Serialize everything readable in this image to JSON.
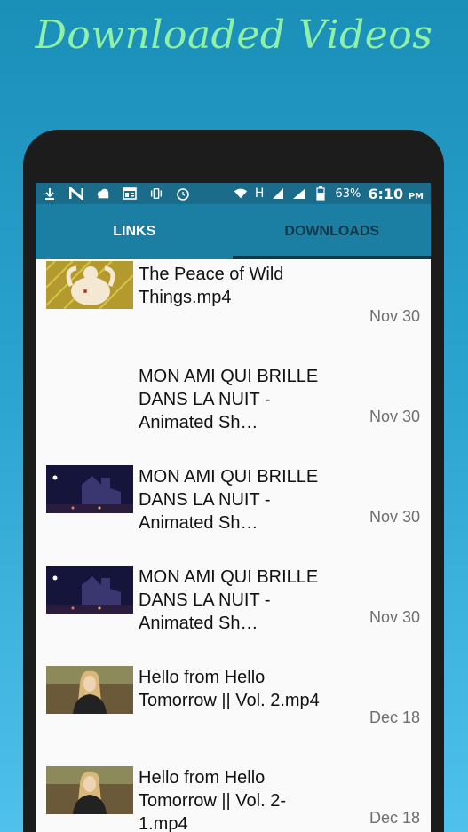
{
  "headline": "Downloaded Videos",
  "status_bar": {
    "icons": [
      "download-icon",
      "n-app-icon",
      "cloud-icon",
      "news-icon",
      "vibrate-icon",
      "alarm-icon",
      "wifi-icon",
      "signal-icon",
      "signal-icon-2",
      "battery-icon"
    ],
    "network_type": "H",
    "battery_percent": "63%",
    "time": "6:10",
    "ampm": "PM"
  },
  "tabs": [
    {
      "label": "LINKS",
      "selected": false
    },
    {
      "label": "DOWNLOADS",
      "selected": true
    }
  ],
  "downloads": [
    {
      "title": "The Peace of Wild Things.mp4",
      "date": "Nov 30",
      "thumb": "illustration"
    },
    {
      "title": "MON AMI QUI BRILLE DANS LA NUIT - Animated Sh…",
      "date": "Nov 30",
      "thumb": "none"
    },
    {
      "title": "MON AMI QUI BRILLE DANS LA NUIT - Animated Sh…",
      "date": "Nov 30",
      "thumb": "night"
    },
    {
      "title": "MON AMI QUI BRILLE DANS LA NUIT - Animated Sh…",
      "date": "Nov 30",
      "thumb": "night"
    },
    {
      "title": "Hello from Hello Tomorrow || Vol. 2.mp4",
      "date": "Dec 18",
      "thumb": "person"
    },
    {
      "title": "Hello from Hello Tomorrow || Vol. 2-1.mp4",
      "date": "Dec 18",
      "thumb": "person"
    }
  ]
}
